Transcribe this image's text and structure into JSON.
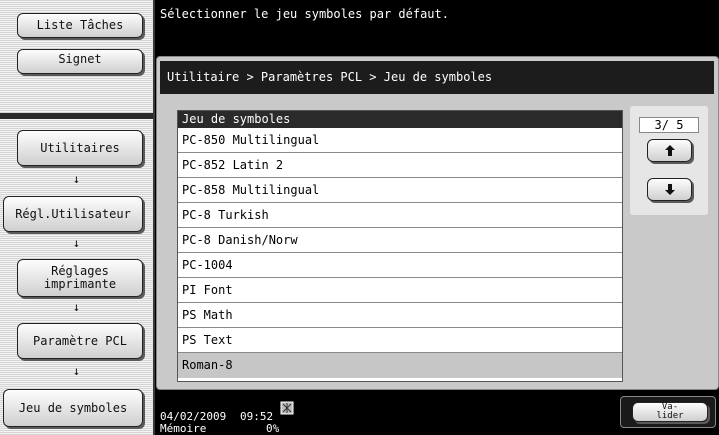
{
  "left_panel": {
    "top_buttons": [
      "Liste Tâches",
      "Signet"
    ],
    "breadcrumb_buttons": [
      "Utilitaires",
      "Régl.Utilisateur",
      "Réglages\nimprimante",
      "Paramètre PCL",
      "Jeu de symboles"
    ],
    "down_arrow": "↓"
  },
  "message": "Sélectionner le jeu symboles par défaut.",
  "path_title": "Utilitaire > Paramètres PCL > Jeu de symboles",
  "list": {
    "header": "Jeu de symboles",
    "items": [
      "PC-850 Multilingual",
      "PC-852 Latin 2",
      "PC-858 Multilingual",
      "PC-8 Turkish",
      "PC-8 Danish/Norw",
      "PC-1004",
      "PI Font",
      "PS Math",
      "PS Text",
      "Roman-8"
    ],
    "selected_item": "Roman-8"
  },
  "pager": {
    "page_text": "3/ 5",
    "up_icon": "arrow-up-icon",
    "down_icon": "arrow-down-icon"
  },
  "status": {
    "date": "04/02/2009",
    "time": "09:52",
    "memory_label": "Mémoire",
    "memory_value": "0%"
  },
  "validate_button": "Va-\nlider"
}
